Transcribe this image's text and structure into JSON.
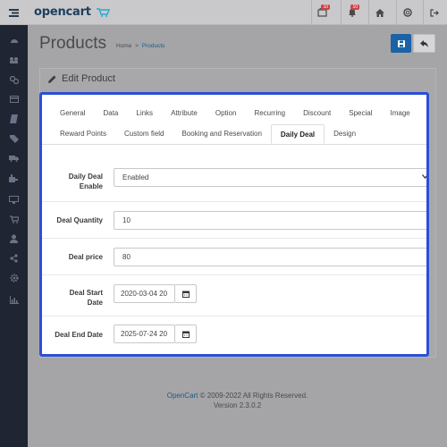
{
  "header": {
    "logo_text": "opencart",
    "badges": {
      "orders": "10",
      "alerts": "10"
    },
    "icons": [
      "menu-icon",
      "cart-icon",
      "bell-icon",
      "home-icon",
      "support-icon",
      "logout-icon"
    ]
  },
  "sidebar": {
    "icons": [
      "dashboard-icon",
      "catalog-icon",
      "extensions-icon",
      "design-icon",
      "sales-icon",
      "tags-icon",
      "shipping-icon",
      "plugin-icon",
      "display-icon",
      "cart-icon",
      "user-icon",
      "share-icon",
      "settings-icon",
      "reports-icon"
    ]
  },
  "page": {
    "title": "Products",
    "breadcrumb": {
      "home": "Home",
      "separator": ">",
      "current": "Products"
    },
    "panel_heading": "Edit Product"
  },
  "tabs": {
    "row1": [
      "General",
      "Data",
      "Links",
      "Attribute",
      "Option",
      "Recurring",
      "Discount",
      "Special",
      "Image"
    ],
    "row2": [
      "Reward Points",
      "Custom field",
      "Booking and Reservation",
      "Daily Deal",
      "Design"
    ],
    "active": "Daily Deal"
  },
  "form": {
    "deal_enable": {
      "label_line1": "Daily Deal",
      "label_line2": "Enable",
      "value": "Enabled"
    },
    "deal_quantity": {
      "label": "Deal Quantity",
      "value": "10"
    },
    "deal_price": {
      "label": "Deal price",
      "value": "80"
    },
    "deal_start": {
      "label_line1": "Deal Start",
      "label_line2": "Date",
      "value": "2020-03-04 20"
    },
    "deal_end": {
      "label": "Deal End Date",
      "value": "2025-07-24 20"
    }
  },
  "footer": {
    "brand": "OpenCart",
    "copyright": " © 2009-2022 All Rights Reserved.",
    "version": "Version 2.3.0.2"
  },
  "colors": {
    "primary": "#1b63a6",
    "highlight_border": "#2b4fd6",
    "sidebar_bg": "#1f2532",
    "badge": "#cc4444"
  }
}
